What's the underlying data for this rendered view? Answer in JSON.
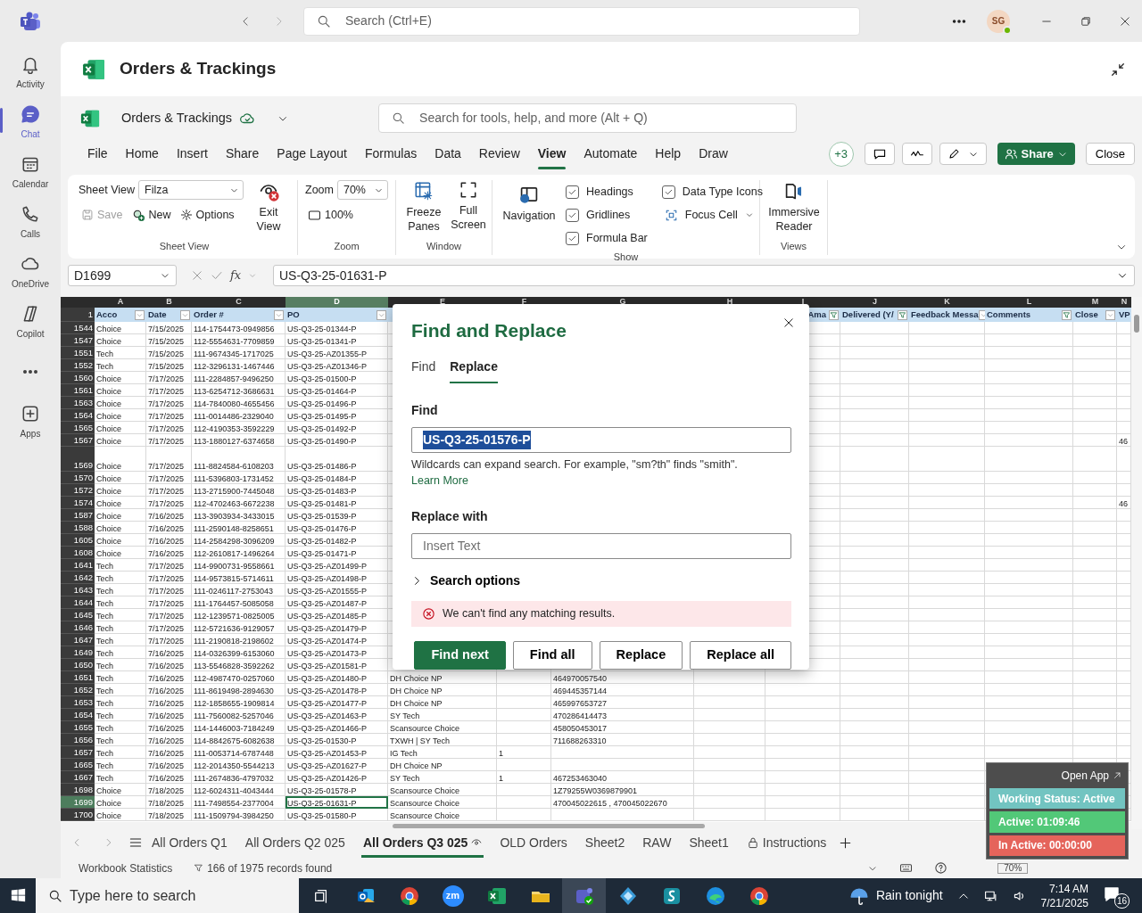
{
  "teams": {
    "search_placeholder": "Search (Ctrl+E)",
    "avatar": "SG",
    "rail": [
      {
        "kind": "activity",
        "label": "Activity",
        "selected": false
      },
      {
        "kind": "chat",
        "label": "Chat",
        "selected": true
      },
      {
        "kind": "calendar",
        "label": "Calendar",
        "selected": false
      },
      {
        "kind": "calls",
        "label": "Calls",
        "selected": false
      },
      {
        "kind": "onedrive",
        "label": "OneDrive",
        "selected": false
      },
      {
        "kind": "copilot",
        "label": "Copilot",
        "selected": false
      },
      {
        "kind": "more",
        "selected": false
      },
      {
        "kind": "apps",
        "label": "Apps",
        "selected": false
      }
    ]
  },
  "tab_title": "Orders & Trackings",
  "excel": {
    "file_name": "Orders & Trackings",
    "search_placeholder": "Search for tools, help, and more (Alt + Q)",
    "menu": [
      {
        "label": "File",
        "selected": false
      },
      {
        "label": "Home",
        "selected": false
      },
      {
        "label": "Insert",
        "selected": false
      },
      {
        "label": "Share",
        "selected": false
      },
      {
        "label": "Page Layout",
        "selected": false
      },
      {
        "label": "Formulas",
        "selected": false
      },
      {
        "label": "Data",
        "selected": false
      },
      {
        "label": "Review",
        "selected": false
      },
      {
        "label": "View",
        "selected": true
      },
      {
        "label": "Automate",
        "selected": false
      },
      {
        "label": "Help",
        "selected": false
      },
      {
        "label": "Draw",
        "selected": false
      }
    ],
    "coauthors": "+3",
    "share": "Share",
    "close": "Close"
  },
  "ribbon": {
    "sheet_view": {
      "label": "Sheet View",
      "view": "Filza",
      "save": {
        "label": "Save",
        "disabled": true
      },
      "new": "New",
      "options": "Options",
      "exit": "Exit View",
      "group": "Sheet View"
    },
    "zoom": {
      "label": "Zoom",
      "value": "70%",
      "reset": "100%",
      "group": "Zoom"
    },
    "window": {
      "freeze": "Freeze Panes",
      "full": "Full Screen",
      "group": "Window"
    },
    "show": {
      "navigation": "Navigation",
      "options": [
        {
          "label": "Headings",
          "checked": true
        },
        {
          "label": "Gridlines",
          "checked": true
        },
        {
          "label": "Formula Bar",
          "checked": true
        },
        {
          "label": "Data Type Icons",
          "checked": true
        }
      ],
      "focus_cell": "Focus Cell",
      "group": "Show"
    },
    "views": {
      "immersive": "Immersive Reader",
      "group": "Views"
    }
  },
  "formula_bar": {
    "name_box": "D1699",
    "function_label": "fx",
    "formula": "US-Q3-25-01631-P"
  },
  "sheet": {
    "header_row": "1",
    "columns": [
      {
        "letter": "A",
        "header": "Acco",
        "filtered": false,
        "selected": false
      },
      {
        "letter": "B",
        "header": "Date",
        "filtered": false,
        "selected": false
      },
      {
        "letter": "C",
        "header": "Order #",
        "filtered": false,
        "selected": false
      },
      {
        "letter": "D",
        "header": "PO",
        "filtered": false,
        "selected": true
      },
      {
        "letter": "E",
        "selected": false
      },
      {
        "letter": "F",
        "selected": false
      },
      {
        "letter": "G",
        "selected": false
      },
      {
        "letter": "H",
        "selected": false
      },
      {
        "letter": "I",
        "header": "Ama",
        "filtered": true,
        "selected": false
      },
      {
        "letter": "J",
        "header": "Delivered (Y/",
        "filtered": true,
        "selected": false
      },
      {
        "letter": "K",
        "header": "Feedback Messa",
        "filtered": false,
        "selected": false
      },
      {
        "letter": "L",
        "header": "Comments",
        "filtered": true,
        "selected": false
      },
      {
        "letter": "M",
        "header": "Close",
        "filtered": false,
        "selected": false
      },
      {
        "letter": "N",
        "header": "VP",
        "selected": false
      }
    ],
    "rows": [
      {
        "num": "1544",
        "account": "Choice",
        "date": "7/15/2025",
        "order_no": "114-1754473-0949856",
        "po": "US-Q3-25-01344-P",
        "tall": false,
        "selected": false
      },
      {
        "num": "1547",
        "account": "Choice",
        "date": "7/15/2025",
        "order_no": "112-5554631-7709859",
        "po": "US-Q3-25-01341-P",
        "tall": false,
        "selected": false
      },
      {
        "num": "1551",
        "account": "Tech",
        "date": "7/15/2025",
        "order_no": "111-9674345-1717025",
        "po": "US-Q3-25-AZ01355-P",
        "tall": false,
        "selected": false
      },
      {
        "num": "1552",
        "account": "Tech",
        "date": "7/15/2025",
        "order_no": "112-3296131-1467446",
        "po": "US-Q3-25-AZ01346-P",
        "tall": false,
        "selected": false
      },
      {
        "num": "1560",
        "account": "Choice",
        "date": "7/17/2025",
        "order_no": "111-2284857-9496250",
        "po": "US-Q3-25-01500-P",
        "tall": false,
        "selected": false
      },
      {
        "num": "1561",
        "account": "Choice",
        "date": "7/17/2025",
        "order_no": "113-6254712-3686631",
        "po": "US-Q3-25-01464-P",
        "tall": false,
        "selected": false
      },
      {
        "num": "1563",
        "account": "Choice",
        "date": "7/17/2025",
        "order_no": "114-7840080-4655456",
        "po": "US-Q3-25-01496-P",
        "tall": false,
        "selected": false
      },
      {
        "num": "1564",
        "account": "Choice",
        "date": "7/17/2025",
        "order_no": "111-0014486-2329040",
        "po": "US-Q3-25-01495-P",
        "tall": false,
        "selected": false
      },
      {
        "num": "1565",
        "account": "Choice",
        "date": "7/17/2025",
        "order_no": "112-4190353-3592229",
        "po": "US-Q3-25-01492-P",
        "tall": false,
        "selected": false
      },
      {
        "num": "1567",
        "account": "Choice",
        "date": "7/17/2025",
        "order_no": "113-1880127-6374658",
        "po": "US-Q3-25-01490-P",
        "column_n": "46",
        "tall": false,
        "selected": false
      },
      {
        "num": "1569",
        "account": "Choice",
        "date": "7/17/2025",
        "order_no": "111-8824584-6108203",
        "po": "US-Q3-25-01486-P",
        "tall": true,
        "selected": false
      },
      {
        "num": "1570",
        "account": "Choice",
        "date": "7/17/2025",
        "order_no": "111-5396803-1731452",
        "po": "US-Q3-25-01484-P",
        "tall": false,
        "selected": false
      },
      {
        "num": "1572",
        "account": "Choice",
        "date": "7/17/2025",
        "order_no": "113-2715900-7445048",
        "po": "US-Q3-25-01483-P",
        "tall": false,
        "selected": false
      },
      {
        "num": "1574",
        "account": "Choice",
        "date": "7/17/2025",
        "order_no": "112-4702463-6672238",
        "po": "US-Q3-25-01481-P",
        "column_n": "46",
        "tall": false,
        "selected": false
      },
      {
        "num": "1587",
        "account": "Choice",
        "date": "7/16/2025",
        "order_no": "113-3903934-3433015",
        "po": "US-Q3-25-01539-P",
        "tall": false,
        "selected": false
      },
      {
        "num": "1588",
        "account": "Choice",
        "date": "7/16/2025",
        "order_no": "111-2590148-8258651",
        "po": "US-Q3-25-01476-P",
        "tall": false,
        "selected": false
      },
      {
        "num": "1605",
        "account": "Choice",
        "date": "7/16/2025",
        "order_no": "114-2584298-3096209",
        "po": "US-Q3-25-01482-P",
        "tall": false,
        "selected": false
      },
      {
        "num": "1608",
        "account": "Choice",
        "date": "7/16/2025",
        "order_no": "112-2610817-1496264",
        "po": "US-Q3-25-01471-P",
        "tall": false,
        "selected": false
      },
      {
        "num": "1641",
        "account": "Tech",
        "date": "7/17/2025",
        "order_no": "114-9900731-9558661",
        "po": "US-Q3-25-AZ01499-P",
        "tall": false,
        "selected": false
      },
      {
        "num": "1642",
        "account": "Tech",
        "date": "7/17/2025",
        "order_no": "114-9573815-5714611",
        "po": "US-Q3-25-AZ01498-P",
        "tall": false,
        "selected": false
      },
      {
        "num": "1643",
        "account": "Tech",
        "date": "7/17/2025",
        "order_no": "111-0246117-2753043",
        "po": "US-Q3-25-AZ01555-P",
        "tall": false,
        "selected": false
      },
      {
        "num": "1644",
        "account": "Tech",
        "date": "7/17/2025",
        "order_no": "111-1764457-5085058",
        "po": "US-Q3-25-AZ01487-P",
        "tall": false,
        "selected": false
      },
      {
        "num": "1645",
        "account": "Tech",
        "date": "7/17/2025",
        "order_no": "112-1239571-0825005",
        "po": "US-Q3-25-AZ01485-P",
        "tall": false,
        "selected": false
      },
      {
        "num": "1646",
        "account": "Tech",
        "date": "7/17/2025",
        "order_no": "112-5721636-9129057",
        "po": "US-Q3-25-AZ01479-P",
        "tall": false,
        "selected": false
      },
      {
        "num": "1647",
        "account": "Tech",
        "date": "7/17/2025",
        "order_no": "111-2190818-2198602",
        "po": "US-Q3-25-AZ01474-P",
        "tall": false,
        "selected": false
      },
      {
        "num": "1649",
        "account": "Tech",
        "date": "7/16/2025",
        "order_no": "114-0326399-6153060",
        "po": "US-Q3-25-AZ01473-P",
        "tall": false,
        "selected": false
      },
      {
        "num": "1650",
        "account": "Tech",
        "date": "7/16/2025",
        "order_no": "113-5546828-3592262",
        "po": "US-Q3-25-AZ01581-P",
        "tall": false,
        "selected": false
      },
      {
        "num": "1651",
        "account": "Tech",
        "date": "7/16/2025",
        "order_no": "112-4987470-0257060",
        "po": "US-Q3-25-AZ01480-P",
        "column_e": "DH Choice NP",
        "column_g": "464970057540",
        "tall": false,
        "selected": false
      },
      {
        "num": "1652",
        "account": "Tech",
        "date": "7/16/2025",
        "order_no": "111-8619498-2894630",
        "po": "US-Q3-25-AZ01478-P",
        "column_e": "DH Choice NP",
        "column_g": "469445357144",
        "tall": false,
        "selected": false
      },
      {
        "num": "1653",
        "account": "Tech",
        "date": "7/16/2025",
        "order_no": "112-1858655-1909814",
        "po": "US-Q3-25-AZ01477-P",
        "column_e": "DH Choice NP",
        "column_g": "465997653727",
        "tall": false,
        "selected": false
      },
      {
        "num": "1654",
        "account": "Tech",
        "date": "7/16/2025",
        "order_no": "111-7560082-5257046",
        "po": "US-Q3-25-AZ01463-P",
        "column_e": "SY Tech",
        "column_g": "470286414473",
        "tall": false,
        "selected": false
      },
      {
        "num": "1655",
        "account": "Tech",
        "date": "7/16/2025",
        "order_no": "114-1446003-7184249",
        "po": "US-Q3-25-AZ01466-P",
        "column_e": "Scansource Choice",
        "column_g": "458050453017",
        "tall": false,
        "selected": false
      },
      {
        "num": "1656",
        "account": "Tech",
        "date": "7/16/2025",
        "order_no": "114-8842675-6082638",
        "po": "US-Q3-25-01530-P",
        "column_e": "TXWH | SY Tech",
        "column_g": "711688263310",
        "tall": false,
        "selected": false
      },
      {
        "num": "1657",
        "account": "Tech",
        "date": "7/16/2025",
        "order_no": "111-0053714-6787448",
        "po": "US-Q3-25-AZ01453-P",
        "column_e": "IG Tech",
        "column_f": "1",
        "tall": false,
        "selected": false
      },
      {
        "num": "1665",
        "account": "Tech",
        "date": "7/16/2025",
        "order_no": "112-2014350-5544213",
        "po": "US-Q3-25-AZ01627-P",
        "column_e": "DH Choice NP",
        "tall": false,
        "selected": false
      },
      {
        "num": "1667",
        "account": "Tech",
        "date": "7/16/2025",
        "order_no": "111-2674836-4797032",
        "po": "US-Q3-25-AZ01426-P",
        "column_e": "SY Tech",
        "column_f": "1",
        "column_g": "467253463040",
        "tall": false,
        "selected": false
      },
      {
        "num": "1698",
        "account": "Choice",
        "date": "7/18/2025",
        "order_no": "112-6024311-4043444",
        "po": "US-Q3-25-01578-P",
        "column_e": "Scansource Choice",
        "column_g": "1Z79255W0369879901",
        "tall": false,
        "selected": false
      },
      {
        "num": "1699",
        "account": "Choice",
        "date": "7/18/2025",
        "order_no": "111-7498554-2377004",
        "po": "US-Q3-25-01631-P",
        "column_e": "Scansource Choice",
        "column_g": "470045022615 , 470045022670",
        "tall": false,
        "selected": true
      },
      {
        "num": "1700",
        "account": "Choice",
        "date": "7/18/2025",
        "order_no": "111-1509794-3984250",
        "po": "US-Q3-25-01580-P",
        "column_e": "Scansource Choice",
        "tall": false,
        "selected": false
      }
    ]
  },
  "dialog": {
    "title": "Find and Replace",
    "tabs": [
      {
        "label": "Find",
        "selected": false
      },
      {
        "label": "Replace",
        "selected": true
      }
    ],
    "find_label": "Find",
    "find_value": "US-Q3-25-01576-P",
    "hint": "Wildcards can expand search. For example, \"sm?th\" finds \"smith\".",
    "learn_more": "Learn More",
    "replace_label": "Replace with",
    "replace_placeholder": "Insert Text",
    "search_options": "Search options",
    "search_options_expanded": false,
    "error": "We can't find any matching results.",
    "buttons": [
      {
        "label": "Find next",
        "kind": "primary"
      },
      {
        "label": "Find all",
        "kind": "secondary"
      },
      {
        "label": "Replace",
        "kind": "secondary"
      },
      {
        "label": "Replace all",
        "kind": "secondary"
      }
    ]
  },
  "sheet_tabs": [
    {
      "label": "All Orders Q1",
      "kind": "plain",
      "selected": false
    },
    {
      "label": "All Orders Q2 025",
      "kind": "plain",
      "selected": false
    },
    {
      "label": "All Orders Q3 025",
      "kind": "watched",
      "selected": true
    },
    {
      "label": "OLD Orders",
      "kind": "plain",
      "selected": false
    },
    {
      "label": "Sheet2",
      "kind": "plain",
      "selected": false
    },
    {
      "label": "RAW",
      "kind": "plain",
      "selected": false
    },
    {
      "label": "Sheet1",
      "kind": "plain",
      "selected": false
    },
    {
      "label": "Instructions",
      "kind": "locked",
      "selected": false
    }
  ],
  "status_bar": {
    "stats": "Workbook Statistics",
    "records": "166 of 1975 records found",
    "zoom": "70%"
  },
  "tracker": {
    "open_app": "Open App",
    "status": "Working Status: Active",
    "active": "Active: 01:09:46",
    "inactive": "In Active: 00:00:00"
  },
  "taskbar": {
    "search_placeholder": "Type here to search",
    "apps": [
      {
        "kind": "outlook",
        "selected": false
      },
      {
        "kind": "chrome",
        "selected": false
      },
      {
        "kind": "zoom",
        "label": "zm",
        "selected": false
      },
      {
        "kind": "excel",
        "selected": false
      },
      {
        "kind": "explorer",
        "selected": false
      },
      {
        "kind": "teams",
        "selected": true
      },
      {
        "kind": "diamond",
        "selected": false
      },
      {
        "kind": "sway",
        "selected": false
      },
      {
        "kind": "edge",
        "selected": false
      },
      {
        "kind": "chrome",
        "selected": false
      }
    ],
    "weather": "Rain tonight",
    "time": "7:14 AM",
    "date": "7/21/2025",
    "notifications": "16"
  }
}
